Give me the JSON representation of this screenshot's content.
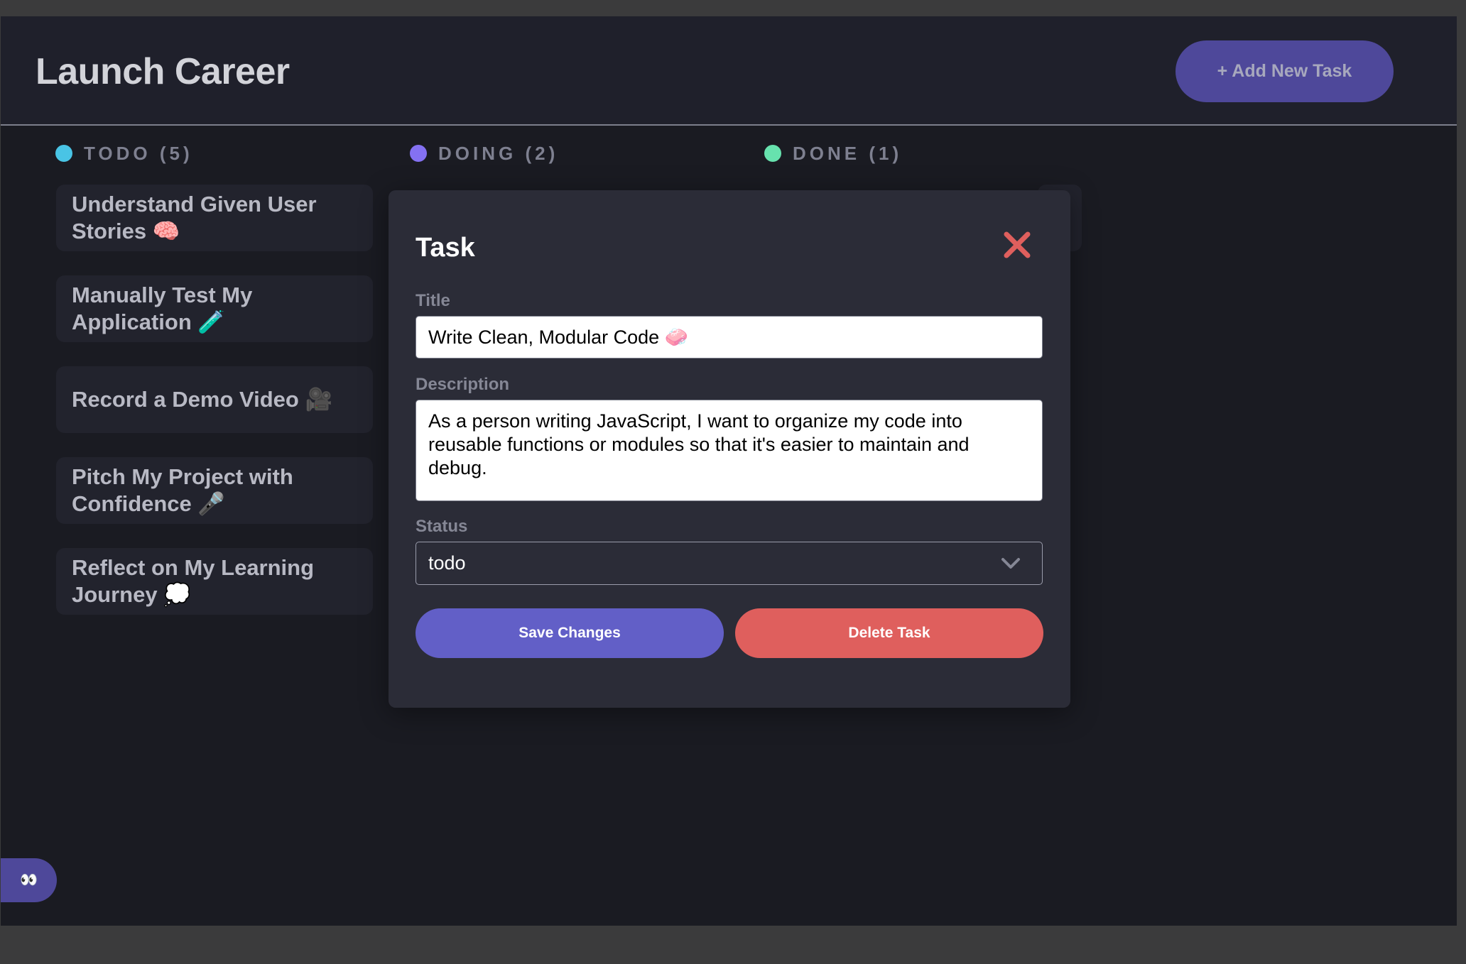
{
  "board": {
    "title": "Launch Career",
    "add_task_label": "+ Add New Task"
  },
  "columns": [
    {
      "label": "TODO (5)",
      "dot_color": "#49c4e5"
    },
    {
      "label": "DOING (2)",
      "dot_color": "#8471f2"
    },
    {
      "label": "DONE (1)",
      "dot_color": "#67e2ae"
    }
  ],
  "todo_cards": [
    "Understand Given User Stories 🧠",
    "Manually Test My Application 🧪",
    "Record a Demo Video 🎥",
    "Pitch My Project with Confidence 🎤",
    "Reflect on My Learning Journey 💭"
  ],
  "floating_button": {
    "icon": "👀"
  },
  "modal": {
    "heading": "Task",
    "title_label": "Title",
    "title_value": "Write Clean, Modular Code 🧼",
    "description_label": "Description",
    "description_value": "As a person writing JavaScript, I want to organize my code into reusable functions or modules so that it's easier to maintain and debug.",
    "status_label": "Status",
    "status_value": "todo",
    "save_label": "Save Changes",
    "delete_label": "Delete Task",
    "close_icon": "close-icon"
  },
  "colors": {
    "accent": "#625fc7",
    "danger": "#df5f5d",
    "background": "#1a1b22",
    "header": "#1f202b",
    "card": "#22232d",
    "modal": "#2b2c37"
  }
}
